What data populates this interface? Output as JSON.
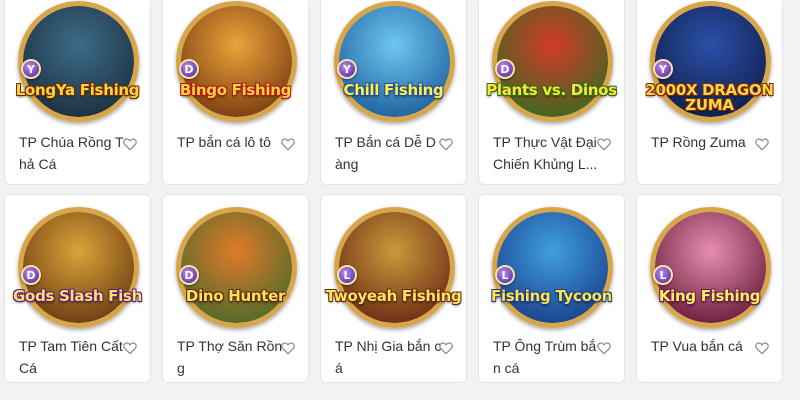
{
  "games": [
    {
      "title": "TP Chúa Rồng Thả Cá",
      "badge": "Y",
      "logo": "LongYa Fishing",
      "colors": {
        "bg1": "#3b6b8a",
        "bg2": "#1d2f3d",
        "logo": "#ffd33d",
        "logo_stroke": "#6a2d00"
      }
    },
    {
      "title": "TP bắn cá lô tô",
      "badge": "D",
      "logo": "Bingo Fishing",
      "colors": {
        "bg1": "#e9a33a",
        "bg2": "#7a3a10",
        "logo": "#ffd23a",
        "logo_stroke": "#b0161a"
      }
    },
    {
      "title": "TP Bắn cá Dễ Dàng",
      "badge": "Y",
      "logo": "Chill Fishing",
      "colors": {
        "bg1": "#6fc6f2",
        "bg2": "#1c5f9c",
        "logo": "#fff14a",
        "logo_stroke": "#1e4e9b"
      }
    },
    {
      "title": "TP Thực Vật Đại Chiến Khủng L...",
      "badge": "D",
      "logo": "Plants vs. Dinos",
      "colors": {
        "bg1": "#d23a2a",
        "bg2": "#3a6a1e",
        "logo": "#ffe23a",
        "logo_stroke": "#2f6a12"
      }
    },
    {
      "title": "TP Rồng Zuma",
      "badge": "Y",
      "logo": "2000X DRAGON ZUMA",
      "colors": {
        "bg1": "#2b4fa8",
        "bg2": "#0f1f4d",
        "logo": "#ffd54a",
        "logo_stroke": "#7a2a00"
      }
    },
    {
      "title": "TP Tam Tiên Cất Cá",
      "badge": "D",
      "logo": "Gods Slash Fish",
      "colors": {
        "bg1": "#d9a43a",
        "bg2": "#6a3a10",
        "logo": "#ffe45a",
        "logo_stroke": "#5a1a8a"
      }
    },
    {
      "title": "TP Thợ Săn Rồng",
      "badge": "D",
      "logo": "Dino Hunter",
      "colors": {
        "bg1": "#e07a2a",
        "bg2": "#4a6a2a",
        "logo": "#ffe05a",
        "logo_stroke": "#5a2a10"
      }
    },
    {
      "title": "TP Nhị Gia bắn cá",
      "badge": "L",
      "logo": "Twoyeah Fishing",
      "colors": {
        "bg1": "#c89a3a",
        "bg2": "#6a2a14",
        "logo": "#ffe26a",
        "logo_stroke": "#6a2a00"
      }
    },
    {
      "title": "TP Ông Trùm bắn cá",
      "badge": "L",
      "logo": "Fishing Tycoon",
      "colors": {
        "bg1": "#3f9fe0",
        "bg2": "#1a3f8a",
        "logo": "#ffe14a",
        "logo_stroke": "#1a3f8a"
      }
    },
    {
      "title": "TP Vua bắn cá",
      "badge": "L",
      "logo": "King Fishing",
      "colors": {
        "bg1": "#e58fb0",
        "bg2": "#6a1a3a",
        "logo": "#fff05a",
        "logo_stroke": "#6a1a5a"
      }
    }
  ],
  "icons": {
    "favorite": "heart-outline-icon"
  },
  "colors": {
    "page_bg": "#f2f2f2",
    "card_bg": "#ffffff",
    "text": "#333333",
    "heart": "#888888"
  }
}
